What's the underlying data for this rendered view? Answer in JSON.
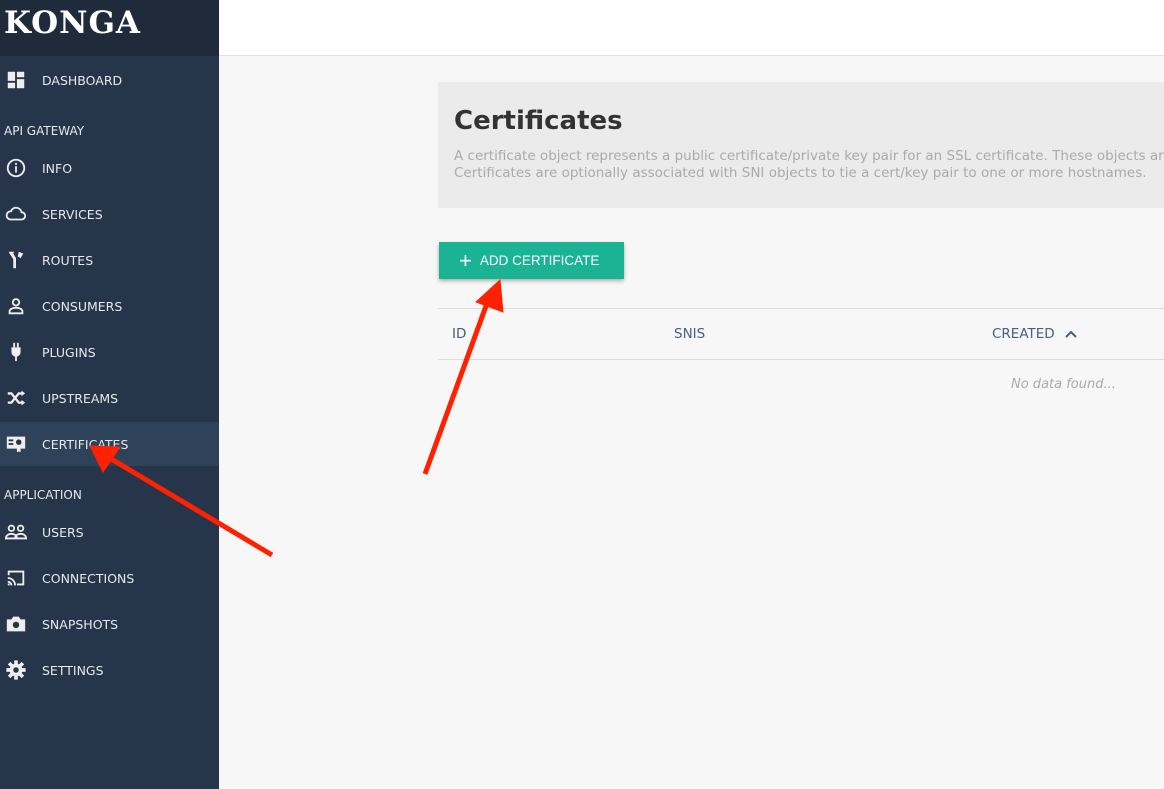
{
  "app": {
    "logo": "KONGA"
  },
  "sidebar": {
    "dashboard": "DASHBOARD",
    "sections": [
      "API GATEWAY",
      "APPLICATION"
    ],
    "items": [
      {
        "label": "INFO",
        "icon": "info-icon"
      },
      {
        "label": "SERVICES",
        "icon": "cloud-icon"
      },
      {
        "label": "ROUTES",
        "icon": "routes-icon"
      },
      {
        "label": "CONSUMERS",
        "icon": "user-icon"
      },
      {
        "label": "PLUGINS",
        "icon": "plug-icon"
      },
      {
        "label": "UPSTREAMS",
        "icon": "shuffle-icon"
      },
      {
        "label": "CERTIFICATES",
        "icon": "certificate-icon",
        "active": true
      },
      {
        "label": "USERS",
        "icon": "users-icon"
      },
      {
        "label": "CONNECTIONS",
        "icon": "cast-icon"
      },
      {
        "label": "SNAPSHOTS",
        "icon": "camera-icon"
      },
      {
        "label": "SETTINGS",
        "icon": "gear-icon"
      }
    ]
  },
  "main": {
    "title": "Certificates",
    "description": [
      "A certificate object represents a public certificate/private key pair for an SSL certificate. These objects are",
      "Certificates are optionally associated with SNI objects to tie a cert/key pair to one or more hostnames."
    ],
    "add_button": "ADD CERTIFICATE",
    "table": {
      "columns": [
        "ID",
        "SNIS",
        "CREATED"
      ],
      "sort": "CREATED ascending",
      "empty": "No data found..."
    }
  },
  "colors": {
    "sidebar": "#263549",
    "accent": "#1ab394",
    "annotation": "#ff2200"
  }
}
